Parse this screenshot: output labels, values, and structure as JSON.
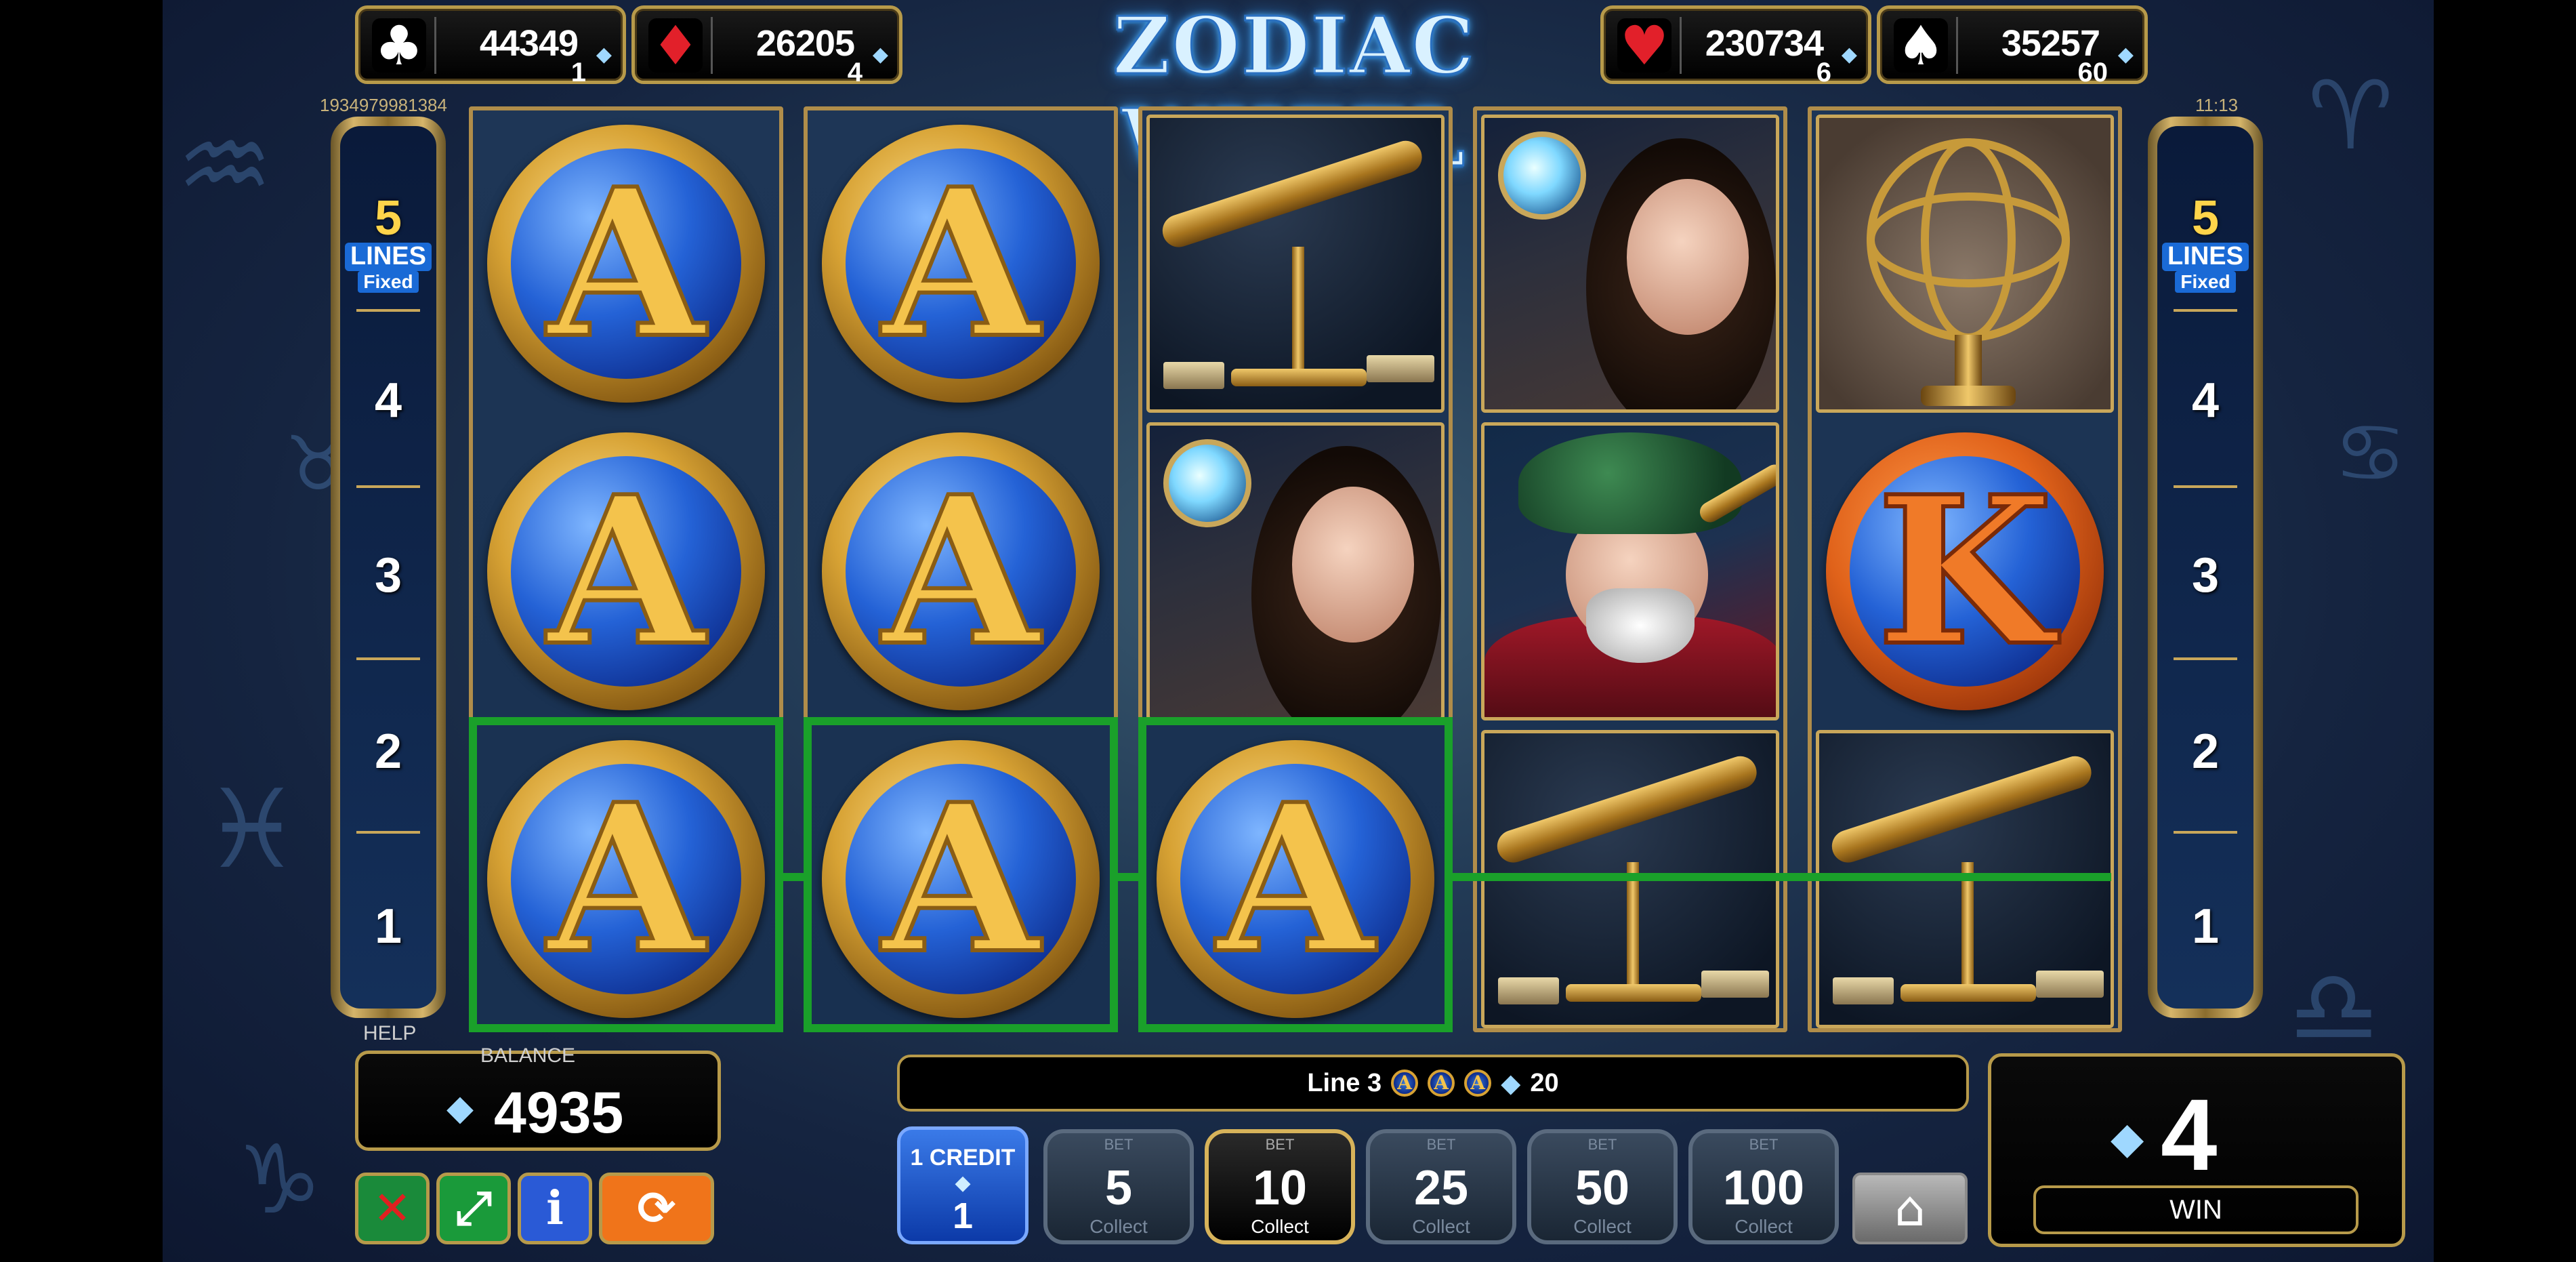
{
  "title": "ZODIAC WHEEL",
  "jackpots": [
    {
      "suit": "clubs-icon",
      "glyph": "♣",
      "amount": "44349",
      "count": "1",
      "suit_color": "#ffffff",
      "tile_color": "#000000"
    },
    {
      "suit": "diamonds-icon",
      "glyph": "♦",
      "amount": "26205",
      "count": "4",
      "suit_color": "#e2202a",
      "tile_color": "#000000"
    },
    {
      "suit": "hearts-icon",
      "glyph": "♥",
      "amount": "230734",
      "count": "6",
      "suit_color": "#e2202a",
      "tile_color": "#000000"
    },
    {
      "suit": "spades-icon",
      "glyph": "♠",
      "amount": "35257",
      "count": "60",
      "suit_color": "#ffffff",
      "tile_color": "#000000"
    }
  ],
  "game_id": "1934979981384",
  "clock": "11:13",
  "lines_panel": {
    "count": "5",
    "label": "LINES",
    "mode": "Fixed",
    "numbers": [
      "4",
      "3",
      "2",
      "1"
    ]
  },
  "reels": [
    [
      "A",
      "A",
      "A"
    ],
    [
      "A",
      "A",
      "A"
    ],
    [
      "telescope",
      "lady",
      "A"
    ],
    [
      "lady",
      "astronomer",
      "telescope"
    ],
    [
      "armillary-sphere",
      "K",
      "telescope"
    ]
  ],
  "help_label": "HELP",
  "balance": {
    "label": "BALANCE",
    "value": "4935"
  },
  "win_message": {
    "line": "Line 3",
    "symbol": "A",
    "symbol_count": 3,
    "amount": "20"
  },
  "win": {
    "value": "4",
    "label": "WIN"
  },
  "credit": {
    "label": "1 CREDIT",
    "value": "1"
  },
  "bets": [
    {
      "label": "BET",
      "value": "5",
      "collect": "Collect",
      "active": false
    },
    {
      "label": "BET",
      "value": "10",
      "collect": "Collect",
      "active": true
    },
    {
      "label": "BET",
      "value": "25",
      "collect": "Collect",
      "active": false
    },
    {
      "label": "BET",
      "value": "50",
      "collect": "Collect",
      "active": false
    },
    {
      "label": "BET",
      "value": "100",
      "collect": "Collect",
      "active": false
    }
  ],
  "controls": [
    {
      "name": "sound-off-icon",
      "glyph": "✕",
      "color": "#1a8a3a"
    },
    {
      "name": "fullscreen-icon",
      "glyph": "⤢",
      "color": "#1a9a3a"
    },
    {
      "name": "info-icon",
      "glyph": "i",
      "color": "#2a5ad6"
    },
    {
      "name": "autoplay-icon",
      "glyph": "⟳",
      "color": "#f0741a"
    }
  ],
  "colors": {
    "win_line": "#1aa02a",
    "gold_frame": "#b79a4a",
    "title_glow": "#4fb6ff"
  }
}
